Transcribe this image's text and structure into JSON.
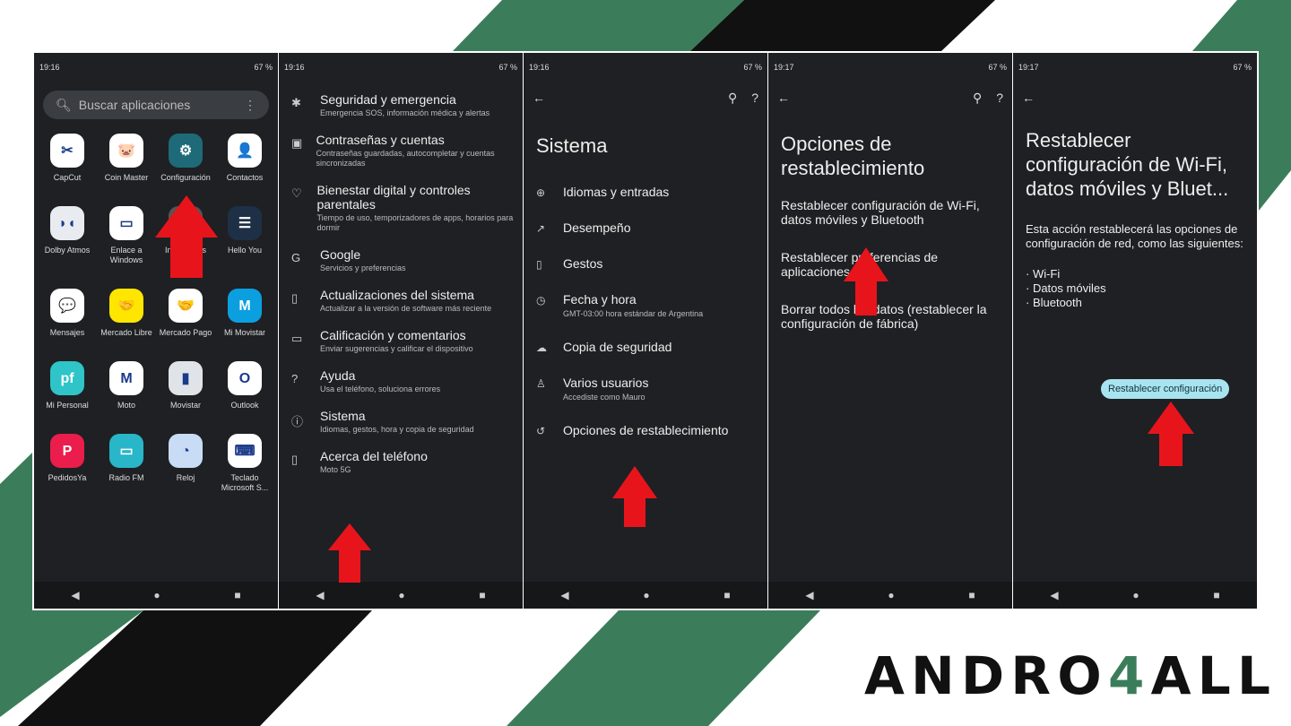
{
  "colors": {
    "green": "#3b7d5a",
    "black": "#111111",
    "panel": "#1f2023",
    "accent_button": "#a8e4f0",
    "arrow": "#e8141c"
  },
  "logo": {
    "text": "ANDRO4ALL"
  },
  "panels": [
    {
      "status": {
        "time": "19:16",
        "battery": "67 %"
      },
      "search_placeholder": "Buscar aplicaciones",
      "apps": [
        {
          "label": "CapCut",
          "color": "#ffffff",
          "glyph": "✂"
        },
        {
          "label": "Coin Master",
          "color": "#ffffff",
          "glyph": "🐷"
        },
        {
          "label": "Configuración",
          "color": "#1e6a78",
          "glyph": "⚙"
        },
        {
          "label": "Contactos",
          "color": "#ffffff",
          "glyph": "👤"
        },
        {
          "label": "Dolby Atmos",
          "color": "#e8ecf0",
          "glyph": "◗◖"
        },
        {
          "label": "Enlace a Windows",
          "color": "#ffffff",
          "glyph": "▭"
        },
        {
          "label": "Interactivos",
          "color": "#555555",
          "glyph": ""
        },
        {
          "label": "Hello You",
          "color": "#1e3046",
          "glyph": "☰"
        },
        {
          "label": "Mensajes",
          "color": "#ffffff",
          "glyph": "💬"
        },
        {
          "label": "Mercado Libre",
          "color": "#ffe600",
          "glyph": "🤝"
        },
        {
          "label": "Mercado Pago",
          "color": "#ffffff",
          "glyph": "🤝"
        },
        {
          "label": "Mi Movistar",
          "color": "#0b9fe0",
          "glyph": "M"
        },
        {
          "label": "Mi Personal",
          "color": "#2ec4c8",
          "glyph": "pf"
        },
        {
          "label": "Moto",
          "color": "#ffffff",
          "glyph": "M"
        },
        {
          "label": "Movistar",
          "color": "#e0e4e8",
          "glyph": "▮"
        },
        {
          "label": "Outlook",
          "color": "#ffffff",
          "glyph": "O"
        },
        {
          "label": "PedidosYa",
          "color": "#ea1d4c",
          "glyph": "P"
        },
        {
          "label": "Radio FM",
          "color": "#29b6c8",
          "glyph": "▭"
        },
        {
          "label": "Reloj",
          "color": "#c8dcf5",
          "glyph": "◔"
        },
        {
          "label": "Teclado Microsoft S...",
          "color": "#ffffff",
          "glyph": "⌨"
        }
      ]
    },
    {
      "status": {
        "time": "19:16",
        "battery": "67 %"
      },
      "items": [
        {
          "icon": "asterisk-icon",
          "glyph": "✱",
          "title": "Seguridad y emergencia",
          "sub": "Emergencia SOS, información médica y alertas"
        },
        {
          "icon": "account-icon",
          "glyph": "▣",
          "title": "Contraseñas y cuentas",
          "sub": "Contraseñas guardadas, autocompletar y cuentas sincronizadas"
        },
        {
          "icon": "wellbeing-icon",
          "glyph": "♡",
          "title": "Bienestar digital y controles parentales",
          "sub": "Tiempo de uso, temporizadores de apps, horarios para dormir"
        },
        {
          "icon": "google-icon",
          "glyph": "G",
          "title": "Google",
          "sub": "Servicios y preferencias"
        },
        {
          "icon": "system-update-icon",
          "glyph": "▯",
          "title": "Actualizaciones del sistema",
          "sub": "Actualizar a la versión de software más reciente"
        },
        {
          "icon": "feedback-icon",
          "glyph": "▭",
          "title": "Calificación y comentarios",
          "sub": "Enviar sugerencias y calificar el dispositivo"
        },
        {
          "icon": "help-icon",
          "glyph": "?",
          "title": "Ayuda",
          "sub": "Usa el teléfono, soluciona errores"
        },
        {
          "icon": "info-icon",
          "glyph": "ⓘ",
          "title": "Sistema",
          "sub": "Idiomas, gestos, hora y copia de seguridad"
        },
        {
          "icon": "phone-icon",
          "glyph": "▯",
          "title": "Acerca del teléfono",
          "sub": "Moto 5G"
        }
      ]
    },
    {
      "status": {
        "time": "19:16",
        "battery": "67 %"
      },
      "title": "Sistema",
      "items": [
        {
          "icon": "globe-icon",
          "glyph": "⊕",
          "title": "Idiomas y entradas",
          "sub": ""
        },
        {
          "icon": "performance-icon",
          "glyph": "↗",
          "title": "Desempeño",
          "sub": ""
        },
        {
          "icon": "gestures-icon",
          "glyph": "▯",
          "title": "Gestos",
          "sub": ""
        },
        {
          "icon": "clock-icon",
          "glyph": "◷",
          "title": "Fecha y hora",
          "sub": "GMT-03:00 hora estándar de Argentina"
        },
        {
          "icon": "backup-icon",
          "glyph": "☁",
          "title": "Copia de seguridad",
          "sub": ""
        },
        {
          "icon": "user-icon",
          "glyph": "♙",
          "title": "Varios usuarios",
          "sub": "Accediste como Mauro"
        },
        {
          "icon": "reset-icon",
          "glyph": "↺",
          "title": "Opciones de restablecimiento",
          "sub": ""
        }
      ]
    },
    {
      "status": {
        "time": "19:17",
        "battery": "67 %"
      },
      "title": "Opciones de restablecimiento",
      "options": [
        "Restablecer configuración de Wi-Fi, datos móviles y Bluetooth",
        "Restablecer preferencias de aplicaciones",
        "Borrar todos los datos (restablecer la configuración de fábrica)"
      ]
    },
    {
      "status": {
        "time": "19:17",
        "battery": "67 %"
      },
      "title": "Restablecer configuración de Wi-Fi, datos móviles y Bluet...",
      "description": "Esta acción restablecerá las opciones de configuración de red, como las siguientes:",
      "list": [
        "· Wi-Fi",
        "· Datos móviles",
        "· Bluetooth"
      ],
      "button": "Restablecer configuración"
    }
  ]
}
